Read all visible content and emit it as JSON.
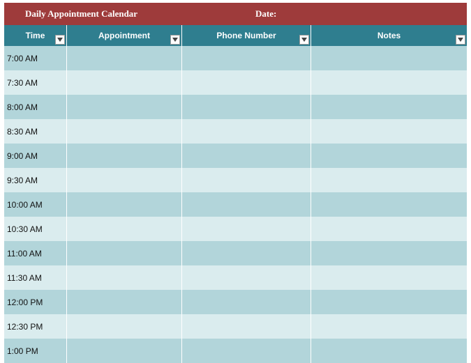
{
  "header": {
    "title": "Daily Appointment Calendar",
    "date_label": "Date:"
  },
  "columns": {
    "time": "Time",
    "appointment": "Appointment",
    "phone": "Phone Number",
    "notes": "Notes"
  },
  "rows": [
    {
      "time": "7:00 AM",
      "appointment": "",
      "phone": "",
      "notes": ""
    },
    {
      "time": "7:30 AM",
      "appointment": "",
      "phone": "",
      "notes": ""
    },
    {
      "time": "8:00 AM",
      "appointment": "",
      "phone": "",
      "notes": ""
    },
    {
      "time": "8:30 AM",
      "appointment": "",
      "phone": "",
      "notes": ""
    },
    {
      "time": "9:00 AM",
      "appointment": "",
      "phone": "",
      "notes": ""
    },
    {
      "time": "9:30 AM",
      "appointment": "",
      "phone": "",
      "notes": ""
    },
    {
      "time": "10:00 AM",
      "appointment": "",
      "phone": "",
      "notes": ""
    },
    {
      "time": "10:30 AM",
      "appointment": "",
      "phone": "",
      "notes": ""
    },
    {
      "time": "11:00 AM",
      "appointment": "",
      "phone": "",
      "notes": ""
    },
    {
      "time": "11:30 AM",
      "appointment": "",
      "phone": "",
      "notes": ""
    },
    {
      "time": "12:00 PM",
      "appointment": "",
      "phone": "",
      "notes": ""
    },
    {
      "time": "12:30 PM",
      "appointment": "",
      "phone": "",
      "notes": ""
    },
    {
      "time": "1:00 PM",
      "appointment": "",
      "phone": "",
      "notes": ""
    }
  ]
}
